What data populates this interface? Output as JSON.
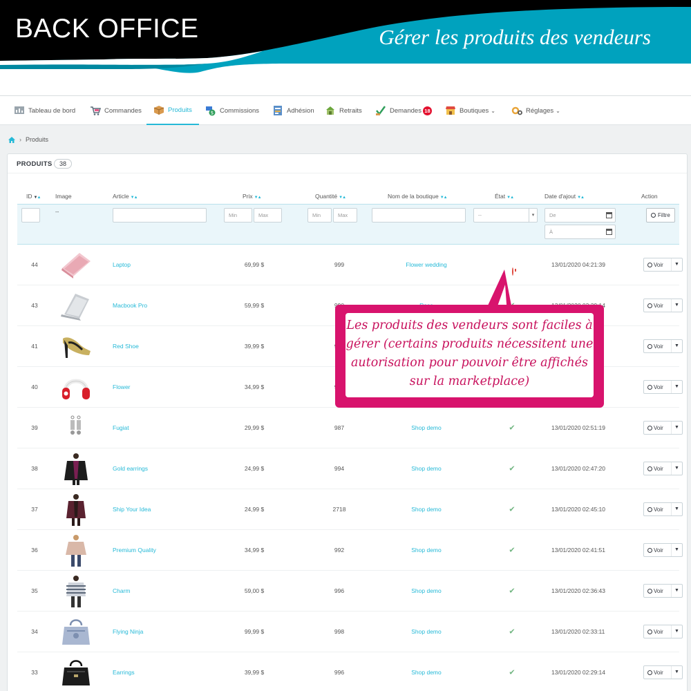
{
  "banner": {
    "title": "BACK OFFICE",
    "subtitle": "Gérer les produits des vendeurs",
    "colors": {
      "dark": "#000000",
      "teal": "#00a2be",
      "white": "#ffffff"
    }
  },
  "nav": {
    "items": [
      {
        "label": "Tableau de bord",
        "icon": "dashboard-icon"
      },
      {
        "label": "Commandes",
        "icon": "cart-icon"
      },
      {
        "label": "Produits",
        "icon": "box-icon",
        "active": true
      },
      {
        "label": "Commissions",
        "icon": "money-icon"
      },
      {
        "label": "Adhésion",
        "icon": "membership-icon"
      },
      {
        "label": "Retraits",
        "icon": "withdraw-icon"
      },
      {
        "label": "Demandes",
        "icon": "request-icon",
        "badge": "18"
      },
      {
        "label": "Boutiques",
        "icon": "shop-icon",
        "dropdown": true
      },
      {
        "label": "Réglages",
        "icon": "gears-icon",
        "dropdown": true
      }
    ],
    "accent": "#25b9d7"
  },
  "breadcrumb": {
    "current": "Produits"
  },
  "panel": {
    "title": "PRODUITS",
    "count": "38"
  },
  "table": {
    "columns": [
      "ID",
      "Image",
      "Article",
      "Prix",
      "Quantité",
      "Nom de la boutique",
      "État",
      "Date d'ajout",
      "Action"
    ],
    "filters": {
      "image_placeholder": "--",
      "price_min": "Min",
      "price_max": "Max",
      "qty_min": "Min",
      "qty_max": "Max",
      "state_value": "--",
      "date_from": "De",
      "date_to": "À",
      "filter_button": "Filtre"
    },
    "view_label": "Voir",
    "rows": [
      {
        "id": "44",
        "image": "pink-laptop",
        "article": "Laptop",
        "price": "69,99 $",
        "qty": "999",
        "shop": "Flower wedding",
        "state": "pending",
        "date": "13/01/2020 04:21:39"
      },
      {
        "id": "43",
        "image": "silver-laptop",
        "article": "Macbook Pro",
        "price": "59,99 $",
        "qty": "990",
        "shop": "Rose",
        "state": "ok",
        "date": "13/01/2020 03:39:14"
      },
      {
        "id": "41",
        "image": "shoe",
        "article": "Red Shoe",
        "price": "39,99 $",
        "qty": "996",
        "shop": "",
        "state": "ok",
        "date": ""
      },
      {
        "id": "40",
        "image": "headphones",
        "article": "Flower",
        "price": "34,99 $",
        "qty": "986",
        "shop": "",
        "state": "ok",
        "date": ""
      },
      {
        "id": "39",
        "image": "earrings",
        "article": "Fugiat",
        "price": "29,99 $",
        "qty": "987",
        "shop": "Shop demo",
        "state": "ok",
        "date": "13/01/2020 02:51:19"
      },
      {
        "id": "38",
        "image": "leather-jacket",
        "article": "Gold earrings",
        "price": "24,99 $",
        "qty": "994",
        "shop": "Shop demo",
        "state": "ok",
        "date": "13/01/2020 02:47:20"
      },
      {
        "id": "37",
        "image": "cardigan",
        "article": "Ship Your Idea",
        "price": "24,99 $",
        "qty": "2718",
        "shop": "Shop demo",
        "state": "ok",
        "date": "13/01/2020 02:45:10"
      },
      {
        "id": "36",
        "image": "sweater",
        "article": "Premium Quality",
        "price": "34,99 $",
        "qty": "992",
        "shop": "Shop demo",
        "state": "ok",
        "date": "13/01/2020 02:41:51"
      },
      {
        "id": "35",
        "image": "striped-sweater",
        "article": "Charm",
        "price": "59,00 $",
        "qty": "996",
        "shop": "Shop demo",
        "state": "ok",
        "date": "13/01/2020 02:36:43"
      },
      {
        "id": "34",
        "image": "blue-handbag",
        "article": "Flying Ninja",
        "price": "99,99 $",
        "qty": "998",
        "shop": "Shop demo",
        "state": "ok",
        "date": "13/01/2020 02:33:11"
      },
      {
        "id": "33",
        "image": "black-handbag",
        "article": "Earrings",
        "price": "39,99 $",
        "qty": "996",
        "shop": "Shop demo",
        "state": "ok",
        "date": "13/01/2020 02:29:14"
      }
    ]
  },
  "callout": {
    "text": "Les produits des vendeurs sont faciles à gérer (certains produits nécessitent une autorisation pour pouvoir être affichés sur la marketplace)",
    "color": "#d8136d"
  }
}
